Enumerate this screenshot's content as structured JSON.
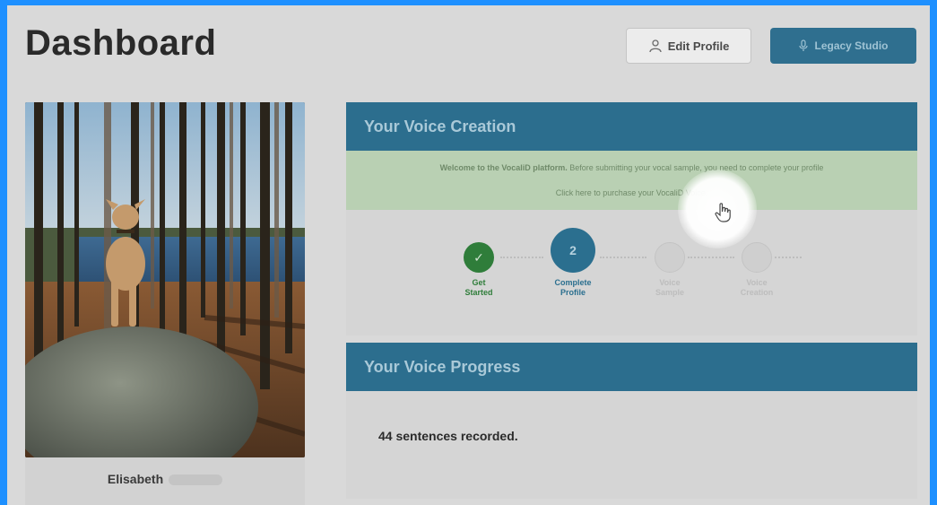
{
  "page": {
    "title": "Dashboard"
  },
  "header": {
    "edit_profile_label": "Edit Profile",
    "legacy_studio_label": "Legacy Studio"
  },
  "profile": {
    "name": "Elisabeth"
  },
  "voice_creation": {
    "title": "Your Voice Creation",
    "welcome_bold": "Welcome to the VocaliD platform.",
    "welcome_rest": "Before submitting your vocal sample, you need to complete your profile",
    "purchase_link": "Click here to purchase your VocaliD Voice.",
    "steps": [
      {
        "number": "✓",
        "label_line1": "Get",
        "label_line2": "Started",
        "state": "done"
      },
      {
        "number": "2",
        "label_line1": "Complete",
        "label_line2": "Profile",
        "state": "active"
      },
      {
        "number": "",
        "label_line1": "Voice",
        "label_line2": "Sample",
        "state": "pending"
      },
      {
        "number": "",
        "label_line1": "Voice",
        "label_line2": "Creation",
        "state": "pending"
      }
    ]
  },
  "voice_progress": {
    "title": "Your Voice Progress",
    "sentences_recorded": "44 sentences recorded."
  },
  "colors": {
    "frame": "#1e90ff",
    "header_blue": "#2c6e8e",
    "step_done": "#2f7d3a",
    "step_active": "#2b6f8f",
    "welcome_green": "#b9d0b3"
  }
}
